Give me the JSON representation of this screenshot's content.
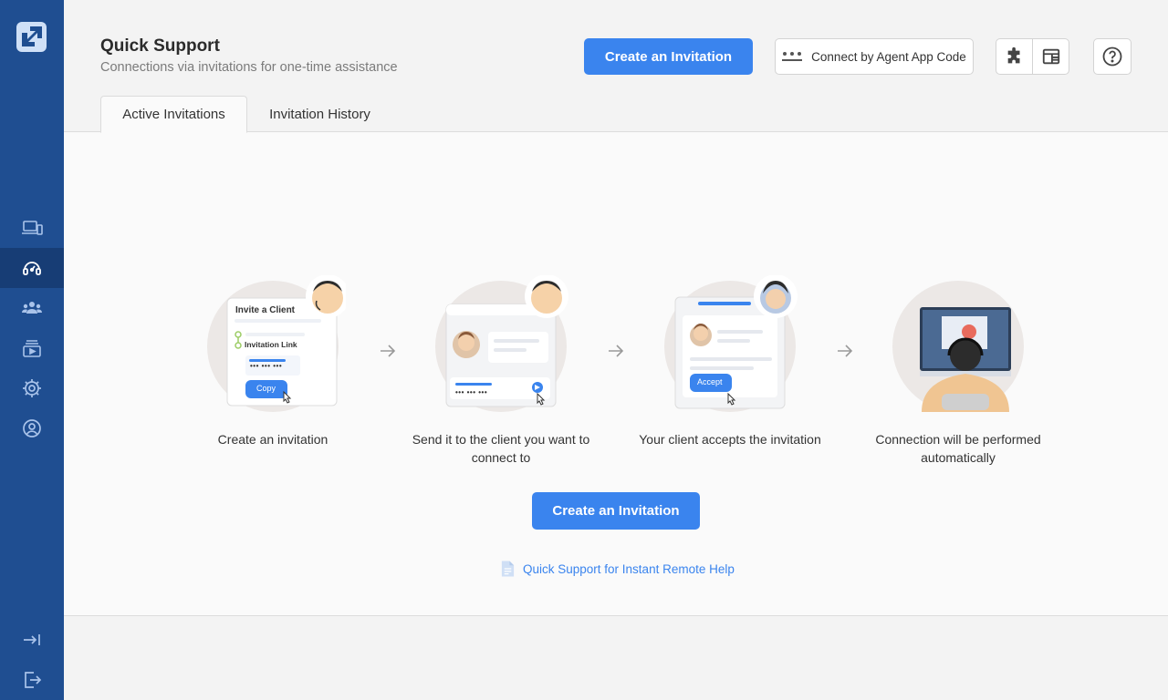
{
  "header": {
    "title": "Quick Support",
    "subtitle": "Connections via invitations for one-time assistance",
    "create_label": "Create an Invitation",
    "agent_code_label": "Connect by Agent App Code",
    "agent_code_dots": "•••"
  },
  "tabs": [
    {
      "label": "Active Invitations",
      "active": true
    },
    {
      "label": "Invitation History",
      "active": false
    }
  ],
  "steps": [
    {
      "label": "Create an invitation",
      "card_title": "Invite a Client",
      "card_link": "Invitation Link",
      "card_code": "••• ••• •••",
      "card_button": "Copy"
    },
    {
      "label": "Send it to the client you want to connect to",
      "card_code": "••• ••• •••"
    },
    {
      "label": "Your client accepts the invitation",
      "card_button": "Accept"
    },
    {
      "label": "Connection will be performed automatically"
    }
  ],
  "main": {
    "create_label": "Create an Invitation",
    "doc_link": "Quick Support for Instant Remote Help"
  },
  "colors": {
    "sidebar": "#1f4e91",
    "sidebar_active": "#173d75",
    "accent": "#3a84ee"
  },
  "sidebar_icons": [
    "devices-icon",
    "quick-support-icon",
    "users-icon",
    "sessions-icon",
    "settings-icon",
    "account-icon",
    "collapse-icon",
    "logout-icon"
  ]
}
